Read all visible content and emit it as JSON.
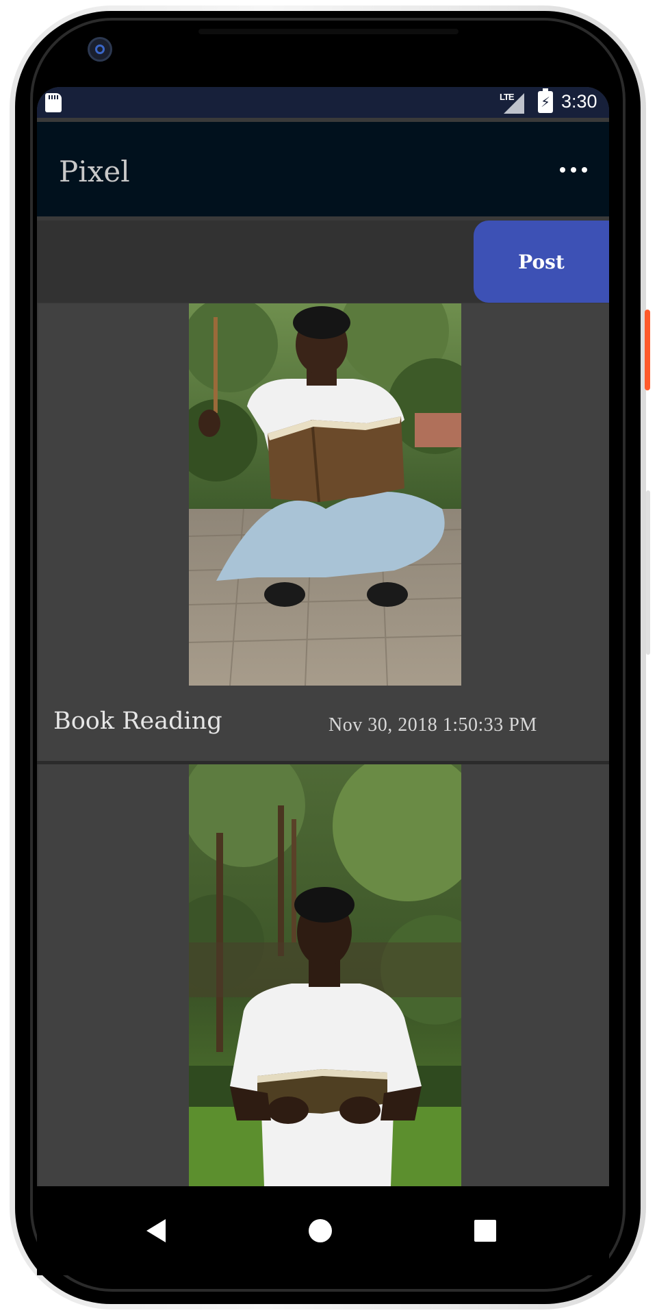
{
  "status_bar": {
    "network": "LTE",
    "time": "3:30"
  },
  "app_bar": {
    "title": "Pixel"
  },
  "compose": {
    "post_label": "Post"
  },
  "posts": [
    {
      "caption": "Book Reading",
      "date": "Nov 30, 2018 1:50:33 PM",
      "image": "man-sitting-reading-book-photo"
    },
    {
      "image": "man-standing-reading-book-photo"
    }
  ],
  "nav": {
    "back": "back-icon",
    "home": "home-icon",
    "recents": "recents-icon"
  },
  "colors": {
    "app_bar": "#01111d",
    "status_bar": "#17203a",
    "post_button": "#3d51b5",
    "card_bg": "#414141"
  }
}
